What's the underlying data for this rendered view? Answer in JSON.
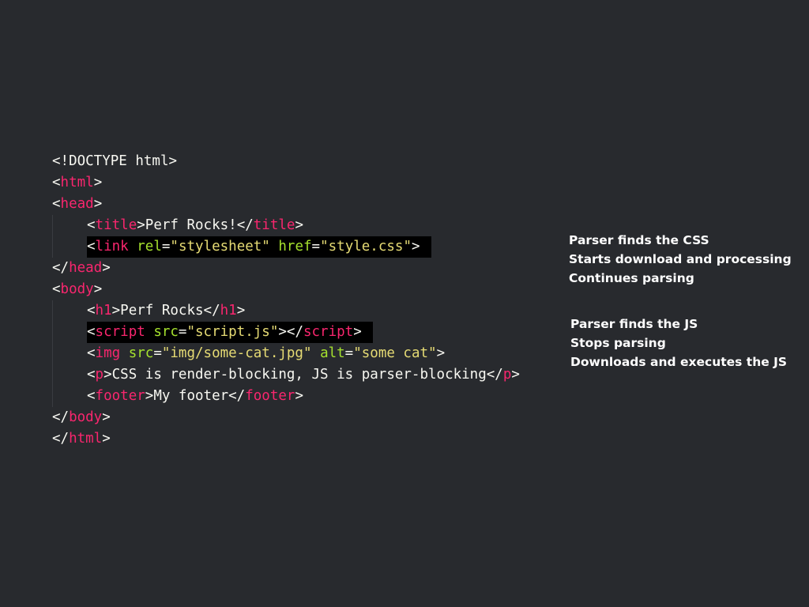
{
  "code_lines": [
    {
      "indent": false,
      "highlight": false,
      "tokens": [
        {
          "t": "<!DOCTYPE html>",
          "c": "punct"
        }
      ]
    },
    {
      "indent": false,
      "highlight": false,
      "tokens": [
        {
          "t": "<",
          "c": "punct"
        },
        {
          "t": "html",
          "c": "tag"
        },
        {
          "t": ">",
          "c": "punct"
        }
      ]
    },
    {
      "indent": false,
      "highlight": false,
      "tokens": [
        {
          "t": "<",
          "c": "punct"
        },
        {
          "t": "head",
          "c": "tag"
        },
        {
          "t": ">",
          "c": "punct"
        }
      ]
    },
    {
      "indent": true,
      "highlight": false,
      "tokens": [
        {
          "t": "<",
          "c": "punct"
        },
        {
          "t": "title",
          "c": "tag"
        },
        {
          "t": ">",
          "c": "punct"
        },
        {
          "t": "Perf Rocks!",
          "c": "txt"
        },
        {
          "t": "</",
          "c": "punct"
        },
        {
          "t": "title",
          "c": "tag"
        },
        {
          "t": ">",
          "c": "punct"
        }
      ]
    },
    {
      "indent": true,
      "highlight": true,
      "tokens": [
        {
          "t": "<",
          "c": "punct"
        },
        {
          "t": "link",
          "c": "tag"
        },
        {
          "t": " ",
          "c": "punct"
        },
        {
          "t": "rel",
          "c": "attr"
        },
        {
          "t": "=",
          "c": "punct"
        },
        {
          "t": "\"stylesheet\"",
          "c": "str"
        },
        {
          "t": " ",
          "c": "punct"
        },
        {
          "t": "href",
          "c": "attr"
        },
        {
          "t": "=",
          "c": "punct"
        },
        {
          "t": "\"style.css\"",
          "c": "str"
        },
        {
          "t": ">",
          "c": "punct"
        }
      ]
    },
    {
      "indent": false,
      "highlight": false,
      "tokens": [
        {
          "t": "</",
          "c": "punct"
        },
        {
          "t": "head",
          "c": "tag"
        },
        {
          "t": ">",
          "c": "punct"
        }
      ]
    },
    {
      "indent": false,
      "highlight": false,
      "tokens": [
        {
          "t": "<",
          "c": "punct"
        },
        {
          "t": "body",
          "c": "tag"
        },
        {
          "t": ">",
          "c": "punct"
        }
      ]
    },
    {
      "indent": true,
      "highlight": false,
      "tokens": [
        {
          "t": "<",
          "c": "punct"
        },
        {
          "t": "h1",
          "c": "tag"
        },
        {
          "t": ">",
          "c": "punct"
        },
        {
          "t": "Perf Rocks",
          "c": "txt"
        },
        {
          "t": "</",
          "c": "punct"
        },
        {
          "t": "h1",
          "c": "tag"
        },
        {
          "t": ">",
          "c": "punct"
        }
      ]
    },
    {
      "indent": true,
      "highlight": true,
      "tokens": [
        {
          "t": "<",
          "c": "punct"
        },
        {
          "t": "script",
          "c": "tag"
        },
        {
          "t": " ",
          "c": "punct"
        },
        {
          "t": "src",
          "c": "attr"
        },
        {
          "t": "=",
          "c": "punct"
        },
        {
          "t": "\"script.js\"",
          "c": "str"
        },
        {
          "t": "></",
          "c": "punct"
        },
        {
          "t": "script",
          "c": "tag"
        },
        {
          "t": ">",
          "c": "punct"
        }
      ]
    },
    {
      "indent": true,
      "highlight": false,
      "tokens": [
        {
          "t": "<",
          "c": "punct"
        },
        {
          "t": "img",
          "c": "tag"
        },
        {
          "t": " ",
          "c": "punct"
        },
        {
          "t": "src",
          "c": "attr"
        },
        {
          "t": "=",
          "c": "punct"
        },
        {
          "t": "\"img/some-cat.jpg\"",
          "c": "str"
        },
        {
          "t": " ",
          "c": "punct"
        },
        {
          "t": "alt",
          "c": "attr"
        },
        {
          "t": "=",
          "c": "punct"
        },
        {
          "t": "\"some cat\"",
          "c": "str"
        },
        {
          "t": ">",
          "c": "punct"
        }
      ]
    },
    {
      "indent": true,
      "highlight": false,
      "tokens": [
        {
          "t": "<",
          "c": "punct"
        },
        {
          "t": "p",
          "c": "tag"
        },
        {
          "t": ">",
          "c": "punct"
        },
        {
          "t": "CSS is render-blocking, JS is parser-blocking",
          "c": "txt"
        },
        {
          "t": "</",
          "c": "punct"
        },
        {
          "t": "p",
          "c": "tag"
        },
        {
          "t": ">",
          "c": "punct"
        }
      ]
    },
    {
      "indent": true,
      "highlight": false,
      "tokens": [
        {
          "t": "<",
          "c": "punct"
        },
        {
          "t": "footer",
          "c": "tag"
        },
        {
          "t": ">",
          "c": "punct"
        },
        {
          "t": "My footer",
          "c": "txt"
        },
        {
          "t": "</",
          "c": "punct"
        },
        {
          "t": "footer",
          "c": "tag"
        },
        {
          "t": ">",
          "c": "punct"
        }
      ]
    },
    {
      "indent": false,
      "highlight": false,
      "tokens": [
        {
          "t": "</",
          "c": "punct"
        },
        {
          "t": "body",
          "c": "tag"
        },
        {
          "t": ">",
          "c": "punct"
        }
      ]
    },
    {
      "indent": false,
      "highlight": false,
      "tokens": [
        {
          "t": "</",
          "c": "punct"
        },
        {
          "t": "html",
          "c": "tag"
        },
        {
          "t": ">",
          "c": "punct"
        }
      ]
    }
  ],
  "notes": {
    "css": [
      "Parser finds the CSS",
      "Starts download and processing",
      "Continues parsing"
    ],
    "js": [
      "Parser finds the JS",
      "Stops parsing",
      "Downloads and executes the JS"
    ]
  },
  "colors": {
    "background": "#282a2e",
    "tag": "#f9266e",
    "attribute": "#a6e22e",
    "string": "#e6db74",
    "text": "#f8f8f2",
    "highlight": "#000000"
  }
}
